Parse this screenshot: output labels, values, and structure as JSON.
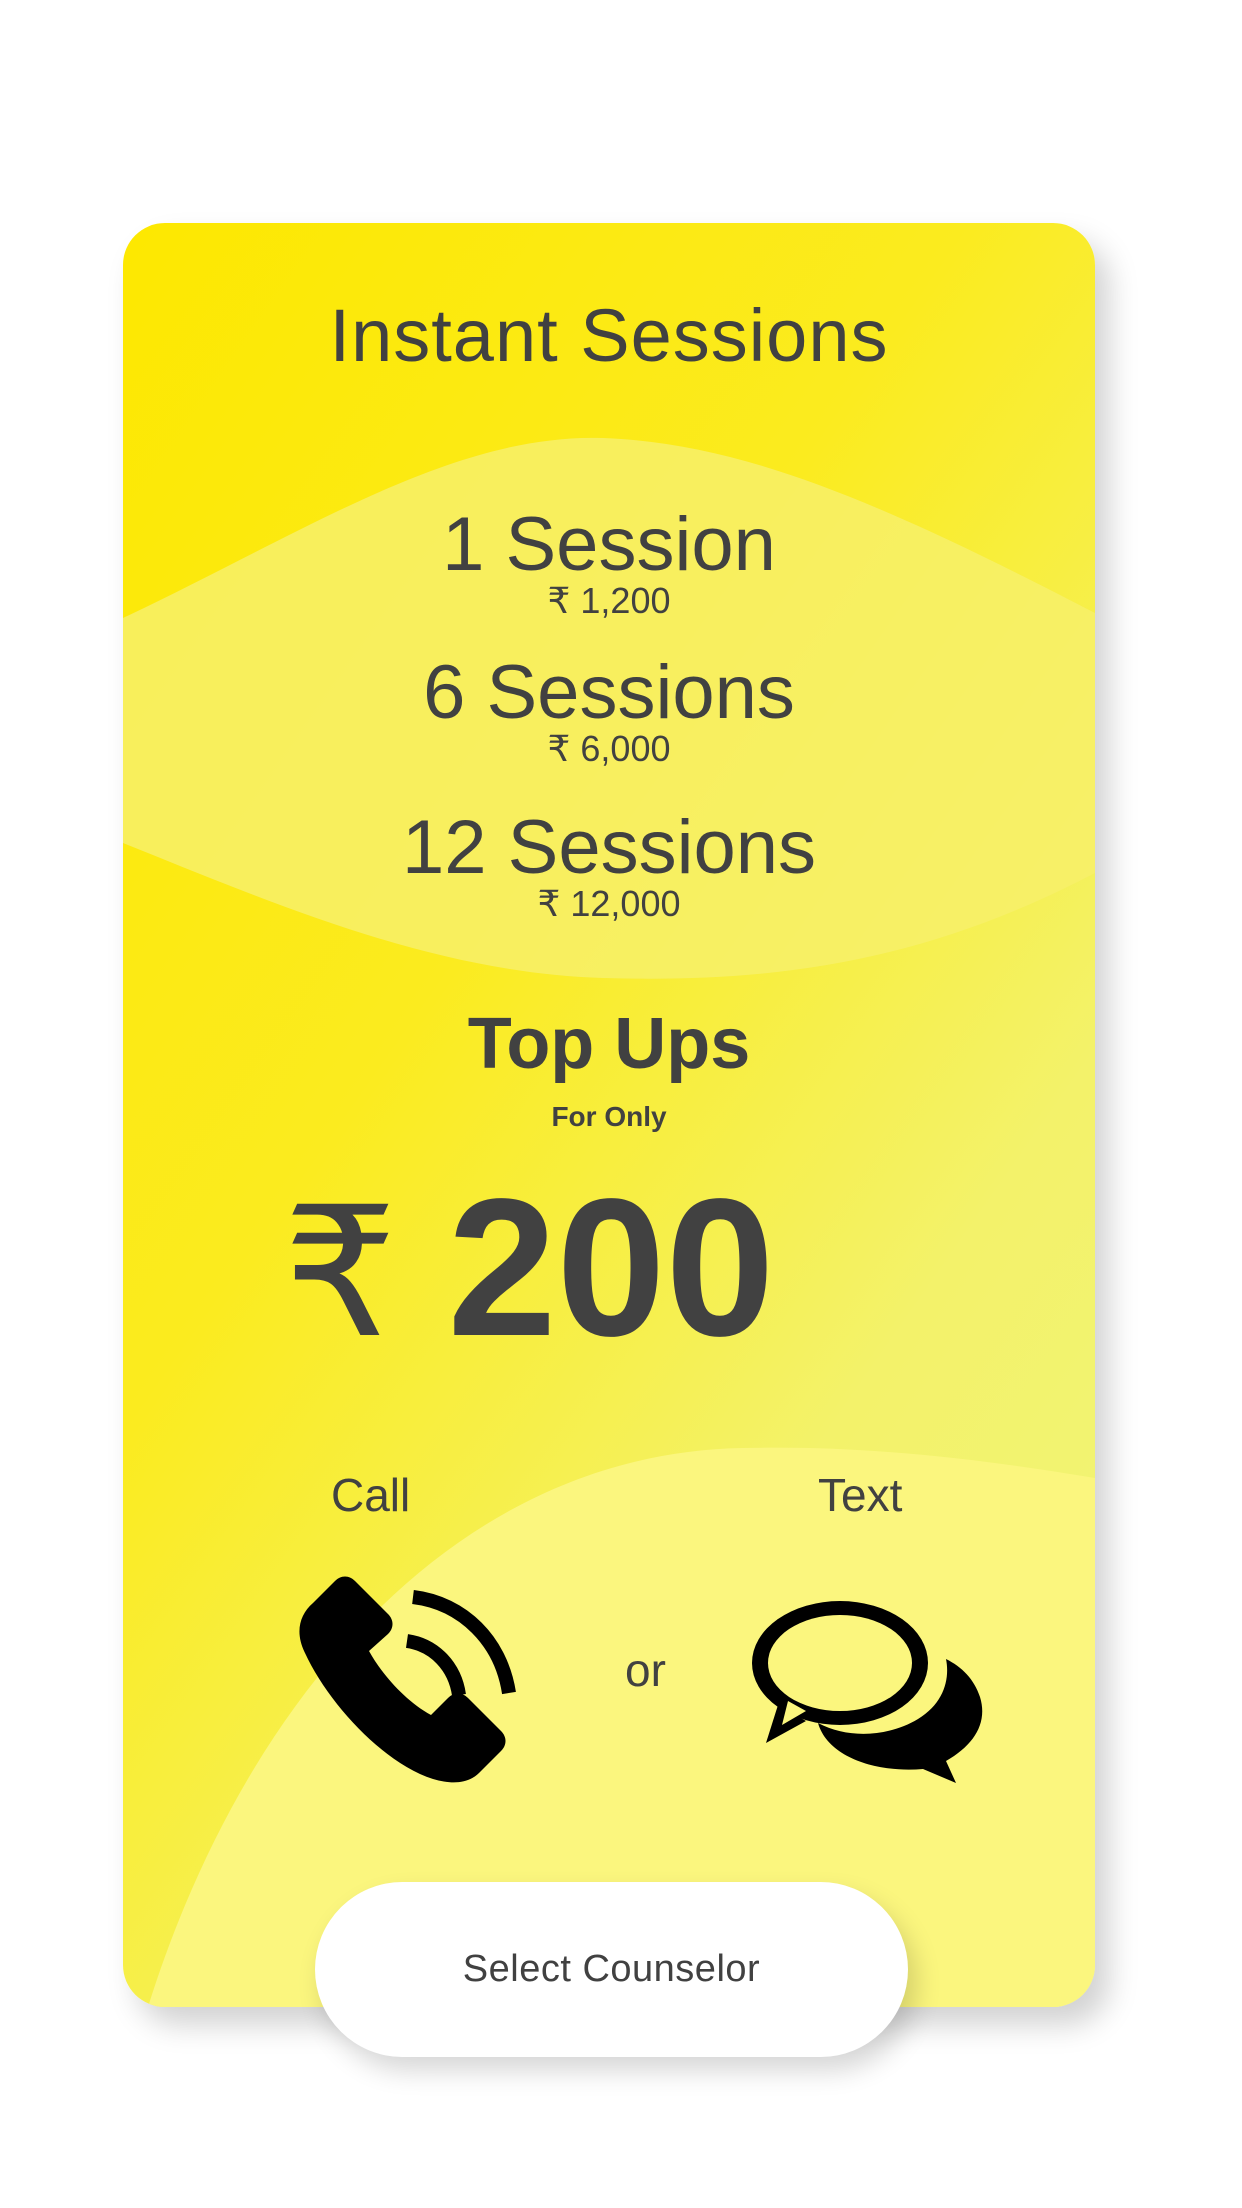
{
  "card": {
    "title": "Instant Sessions",
    "plans": [
      {
        "name": "1 Session",
        "price": "₹ 1,200"
      },
      {
        "name": "6 Sessions",
        "price": "₹ 6,000"
      },
      {
        "name": "12 Sessions",
        "price": "₹ 12,000"
      }
    ],
    "topups": {
      "title": "Top Ups",
      "subtitle": "For Only",
      "currency": "₹",
      "amount": "200"
    },
    "options": {
      "call_label": "Call",
      "or_label": "or",
      "text_label": "Text"
    },
    "cta_label": "Select Counselor"
  },
  "icons": {
    "call": "phone-call-icon",
    "text": "chat-bubbles-icon"
  },
  "colors": {
    "card_yellow": "#fde800",
    "card_light": "#f1f57a",
    "wave_light": "#fbf67e",
    "text": "#414141",
    "button": "#ffffff"
  }
}
